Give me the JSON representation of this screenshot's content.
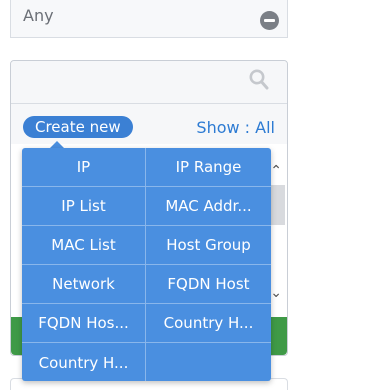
{
  "selection": {
    "value": "Any",
    "remove_icon": "minus-circle-icon"
  },
  "search": {
    "placeholder": "",
    "icon": "search-icon"
  },
  "toolbar": {
    "create_new_label": "Create new",
    "show_all_label": "Show : All"
  },
  "create_menu": {
    "items": [
      {
        "label": "IP"
      },
      {
        "label": "IP Range"
      },
      {
        "label": "IP List"
      },
      {
        "label": "MAC Addr..."
      },
      {
        "label": "MAC List"
      },
      {
        "label": "Host Group"
      },
      {
        "label": "Network"
      },
      {
        "label": "FQDN Host"
      },
      {
        "label": "FQDN Hos..."
      },
      {
        "label": "Country H..."
      },
      {
        "label": "Country H..."
      },
      {
        "label": ""
      }
    ]
  },
  "colors": {
    "accent": "#3b80d4",
    "menu_bg": "#4a8fe0",
    "link": "#2d7bd3",
    "ok_bar": "#3f9a47"
  }
}
